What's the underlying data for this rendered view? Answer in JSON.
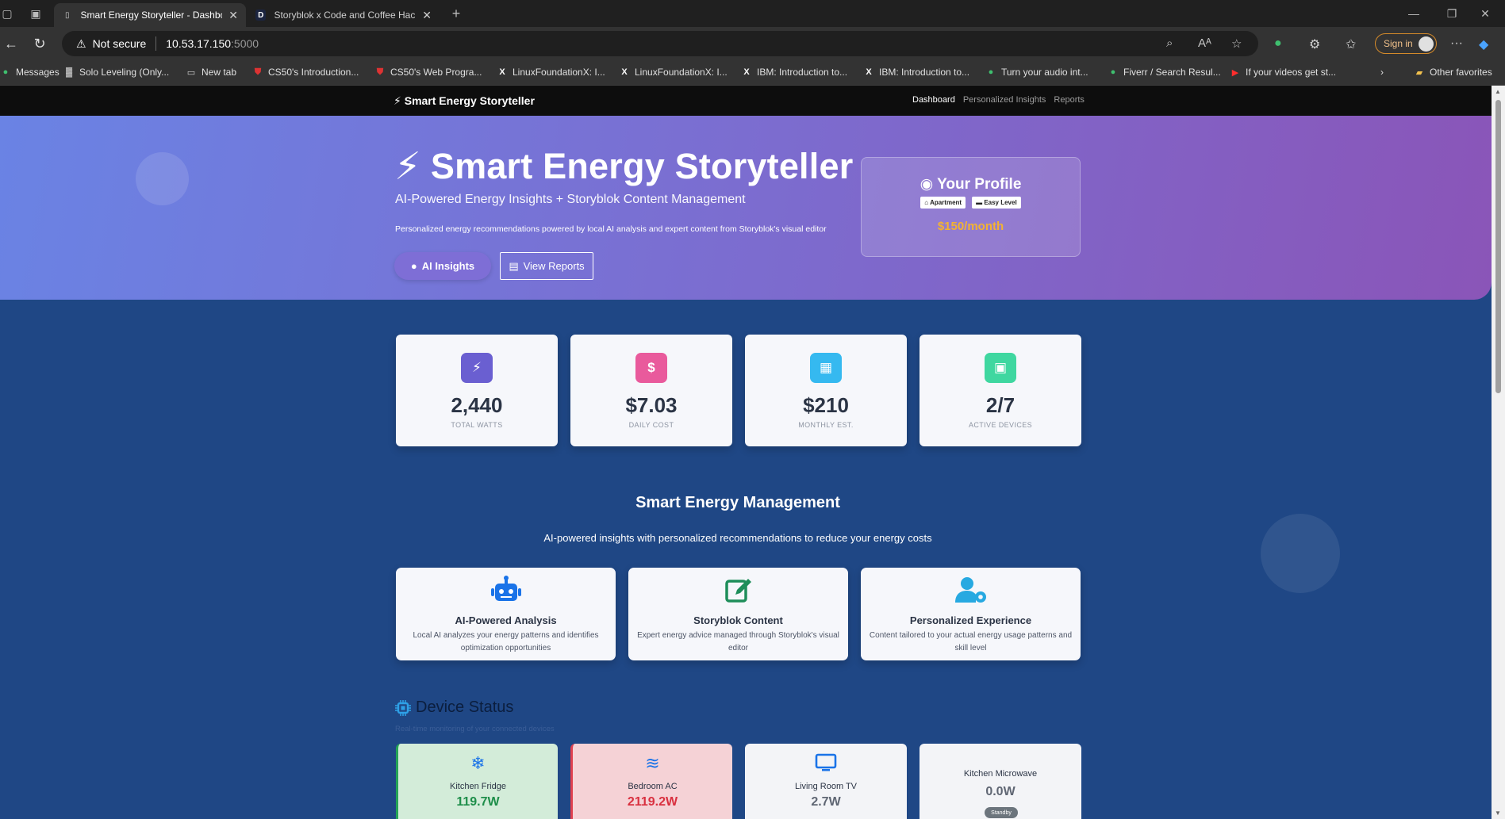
{
  "browser": {
    "tabs": [
      {
        "title": "Smart Energy Storyteller - Dashbo",
        "active": true
      },
      {
        "title": "Storyblok x Code and Coffee Hac",
        "active": false
      }
    ],
    "security_label": "Not secure",
    "url_host": "10.53.17.150",
    "url_port": ":5000",
    "signin_label": "Sign in",
    "bookmarks": [
      "Messages",
      "Solo Leveling (Only...",
      "New tab",
      "CS50's Introduction...",
      "CS50's Web Progra...",
      "LinuxFoundationX: I...",
      "LinuxFoundationX: I...",
      "IBM: Introduction to...",
      "IBM: Introduction to...",
      "Turn your audio int...",
      "Fiverr / Search Resul...",
      "If your videos get st..."
    ],
    "other_favorites": "Other favorites"
  },
  "site": {
    "brand": "Smart Energy Storyteller",
    "nav": [
      "Dashboard",
      "Personalized Insights",
      "Reports"
    ]
  },
  "hero": {
    "title": "Smart Energy Storyteller",
    "subtitle": "AI-Powered Energy Insights + Storyblok Content Management",
    "description": "Personalized energy recommendations powered by local AI analysis and expert content from Storyblok's visual editor",
    "btn_ai": "AI Insights",
    "btn_reports": "View Reports"
  },
  "profile": {
    "title": "Your Profile",
    "tag_home": "Apartment",
    "tag_level": "Easy Level",
    "budget": "$150/month"
  },
  "stats": [
    {
      "value": "2,440",
      "label": "TOTAL WATTS",
      "color": "#6a5fd1"
    },
    {
      "value": "$7.03",
      "label": "DAILY COST",
      "color": "#e95a9c"
    },
    {
      "value": "$210",
      "label": "MONTHLY EST.",
      "color": "#35b9f0"
    },
    {
      "value": "2/7",
      "label": "ACTIVE DEVICES",
      "color": "#3fd7a0"
    }
  ],
  "management": {
    "title": "Smart Energy Management",
    "subtitle": "AI-powered insights with personalized recommendations to reduce your energy costs"
  },
  "features": [
    {
      "title": "AI-Powered Analysis",
      "desc": "Local AI analyzes your energy patterns and identifies optimization opportunities"
    },
    {
      "title": "Storyblok Content",
      "desc": "Expert energy advice managed through Storyblok's visual editor"
    },
    {
      "title": "Personalized Experience",
      "desc": "Content tailored to your actual energy usage patterns and skill level"
    }
  ],
  "devices_section": {
    "title": "Device Status",
    "subtitle": "Real-time monitoring of your connected devices"
  },
  "devices": [
    {
      "name": "Kitchen Fridge",
      "watts": "119.7W"
    },
    {
      "name": "Bedroom AC",
      "watts": "2119.2W"
    },
    {
      "name": "Living Room TV",
      "watts": "2.7W"
    },
    {
      "name": "Kitchen Microwave",
      "watts": "0.0W",
      "badge": "Standby"
    }
  ]
}
